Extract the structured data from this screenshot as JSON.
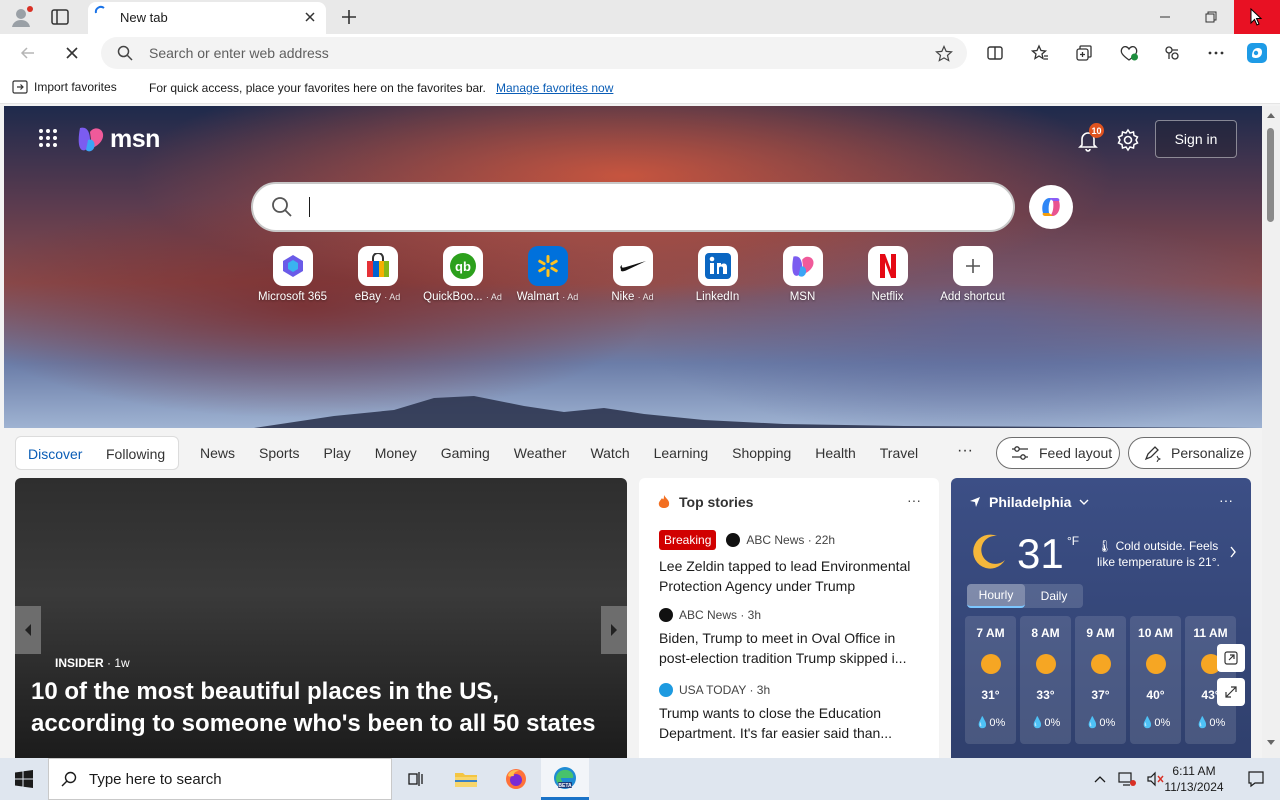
{
  "browser": {
    "tab_title": "New tab",
    "address_placeholder": "Search or enter web address"
  },
  "favorites_bar": {
    "import_label": "Import favorites",
    "message": "For quick access, place your favorites here on the favorites bar.",
    "manage_link": "Manage favorites now"
  },
  "msn": {
    "logo_text": "msn",
    "notification_count": "10",
    "sign_in": "Sign in",
    "shortcuts": [
      {
        "label": "Microsoft 365",
        "ad": "",
        "icon": "microsoft365-icon"
      },
      {
        "label": "eBay",
        "ad": "· Ad",
        "icon": "ebay-icon"
      },
      {
        "label": "QuickBoo...",
        "ad": "· Ad",
        "icon": "quickbooks-icon"
      },
      {
        "label": "Walmart",
        "ad": "· Ad",
        "icon": "walmart-icon"
      },
      {
        "label": "Nike",
        "ad": "· Ad",
        "icon": "nike-icon"
      },
      {
        "label": "LinkedIn",
        "ad": "",
        "icon": "linkedin-icon"
      },
      {
        "label": "MSN",
        "ad": "",
        "icon": "msn-icon"
      },
      {
        "label": "Netflix",
        "ad": "",
        "icon": "netflix-icon"
      },
      {
        "label": "Add shortcut",
        "ad": "",
        "icon": "plus-icon"
      }
    ]
  },
  "nav": {
    "discover": "Discover",
    "following": "Following",
    "items": [
      "News",
      "Sports",
      "Play",
      "Money",
      "Gaming",
      "Weather",
      "Watch",
      "Learning",
      "Shopping",
      "Health",
      "Travel"
    ],
    "more": "···",
    "feed_layout": "Feed layout",
    "personalize": "Personalize"
  },
  "hero_card": {
    "source": "INSIDER",
    "age": "· 1w",
    "title": "10 of the most beautiful places in the US, according to someone who's been to all 50 states"
  },
  "top_stories": {
    "heading": "Top stories",
    "more": "···",
    "items": [
      {
        "badge": "Breaking",
        "source": "ABC News · 22h",
        "title": "Lee Zeldin tapped to lead Environmental Protection Agency under Trump"
      },
      {
        "badge": "",
        "source": "ABC News · 3h",
        "title": "Biden, Trump to meet in Oval Office in post-election tradition Trump skipped i..."
      },
      {
        "badge": "",
        "source": "USA TODAY · 3h",
        "title": "Trump wants to close the Education Department. It's far easier said than..."
      }
    ]
  },
  "weather": {
    "location": "Philadelphia",
    "more": "···",
    "temp": "31",
    "unit": "°F",
    "description": "Cold outside. Feels like temperature is 21°.",
    "tab_hourly": "Hourly",
    "tab_daily": "Daily",
    "hours": [
      {
        "time": "7 AM",
        "temp": "31°",
        "precip": "0%"
      },
      {
        "time": "8 AM",
        "temp": "33°",
        "precip": "0%"
      },
      {
        "time": "9 AM",
        "temp": "37°",
        "precip": "0%"
      },
      {
        "time": "10 AM",
        "temp": "40°",
        "precip": "0%"
      },
      {
        "time": "11 AM",
        "temp": "43°",
        "precip": "0%"
      }
    ]
  },
  "taskbar": {
    "search_placeholder": "Type here to search",
    "time": "6:11 AM",
    "date": "11/13/2024"
  },
  "colors": {
    "accent": "#0a5db6",
    "breaking": "#d10000",
    "close_red": "#e81123"
  }
}
